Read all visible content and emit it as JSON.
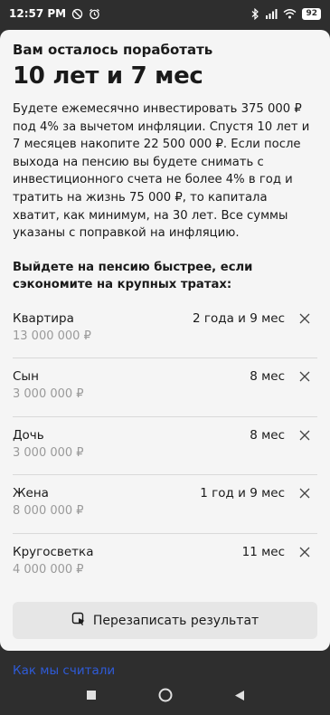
{
  "status_bar": {
    "time": "12:57 PM",
    "battery": "92",
    "icons": [
      "do-not-disturb-icon",
      "alarm-icon",
      "bluetooth-icon",
      "signal-icon",
      "wifi-icon",
      "battery-icon"
    ]
  },
  "header": {
    "subtitle": "Вам осталось поработать",
    "title": "10 лет и 7 мес"
  },
  "description": "Будете ежемесячно инвестировать 375 000 ₽ под 4% за вычетом инфляции. Спустя 10 лет и 7 месяцев накопите 22 500 000 ₽. Если после выхода на пенсию вы будете снимать с инвестиционного счета не более 4% в год и тратить на жизнь 75 000 ₽, то капитала хватит, как минимум, на 30 лет. Все суммы указаны с поправкой на инфляцию.",
  "savings": {
    "heading": "Выйдете на пенсию быстрее, если сэкономите на крупных тратах:",
    "items": [
      {
        "name": "Квартира",
        "amount": "13 000 000 ₽",
        "time": "2 года и 9 мес"
      },
      {
        "name": "Сын",
        "amount": "3 000 000 ₽",
        "time": "8 мес"
      },
      {
        "name": "Дочь",
        "amount": "3 000 000 ₽",
        "time": "8 мес"
      },
      {
        "name": "Жена",
        "amount": "8 000 000 ₽",
        "time": "1 год и 9 мес"
      },
      {
        "name": "Кругосветка",
        "amount": "4 000 000 ₽",
        "time": "11 мес"
      }
    ]
  },
  "actions": {
    "rewrite_label": "Перезаписать результат"
  },
  "footer_link": "Как мы считали",
  "colors": {
    "background": "#2e2e2e",
    "card": "#f5f5f5",
    "button": "#e6e6e6",
    "secondary_text": "#9a9a9a",
    "link": "#2e5bd8"
  }
}
